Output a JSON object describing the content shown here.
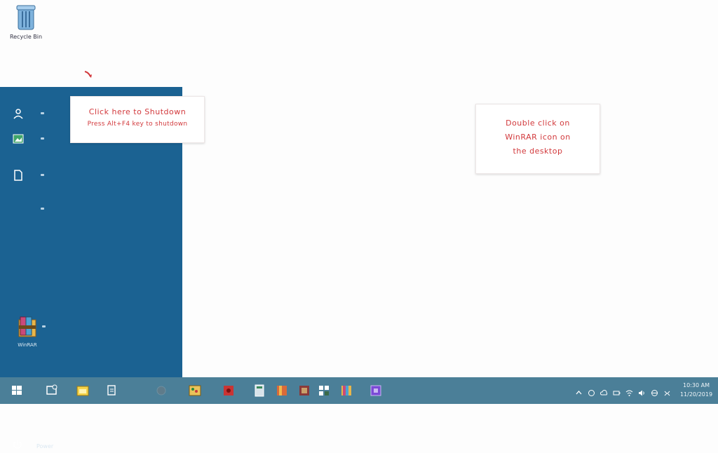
{
  "desktop": {
    "icons": [
      {
        "label": "Recycle Bin",
        "icon": "recycle-bin-icon"
      }
    ]
  },
  "start_menu": {
    "rail": [
      {
        "icon": "user-icon"
      },
      {
        "icon": "image-icon"
      },
      {
        "icon": "document-icon"
      },
      {
        "icon": "settings-icon"
      }
    ],
    "pinned_app": {
      "label": "WinRAR",
      "icon": "archive-icon"
    },
    "power": {
      "label": "Power",
      "icon": "power-icon"
    }
  },
  "callouts": [
    {
      "line1": "Click here to Shutdown",
      "line2": "Press Alt+F4 key to shutdown"
    },
    {
      "lines": [
        "Double click on",
        "WinRAR icon on",
        "the desktop"
      ]
    }
  ],
  "taskbar": {
    "start_icon": "windows-start-icon",
    "apps": [
      {
        "name": "task-view-icon"
      },
      {
        "name": "file-explorer-icon"
      },
      {
        "name": "search-icon"
      },
      {
        "name": "media-player-icon"
      },
      {
        "name": "paint-icon"
      },
      {
        "name": "recorder-icon"
      },
      {
        "name": "calculator-icon"
      },
      {
        "name": "winrar-icon"
      },
      {
        "name": "settings-icon"
      },
      {
        "name": "network-icon"
      },
      {
        "name": "archive-icon"
      },
      {
        "name": "app-icon"
      }
    ],
    "tray": [
      {
        "name": "chevron-up-icon"
      },
      {
        "name": "security-icon"
      },
      {
        "name": "cloud-icon"
      },
      {
        "name": "battery-icon"
      },
      {
        "name": "wifi-icon"
      },
      {
        "name": "volume-icon"
      },
      {
        "name": "language-icon"
      },
      {
        "name": "notification-icon"
      }
    ],
    "clock": {
      "time": "10:30 AM",
      "date": "11/20/2019"
    }
  },
  "colors": {
    "start_menu_bg": "#1b6292",
    "taskbar_bg": "#4b7f98",
    "callout_text": "#d2393c"
  }
}
